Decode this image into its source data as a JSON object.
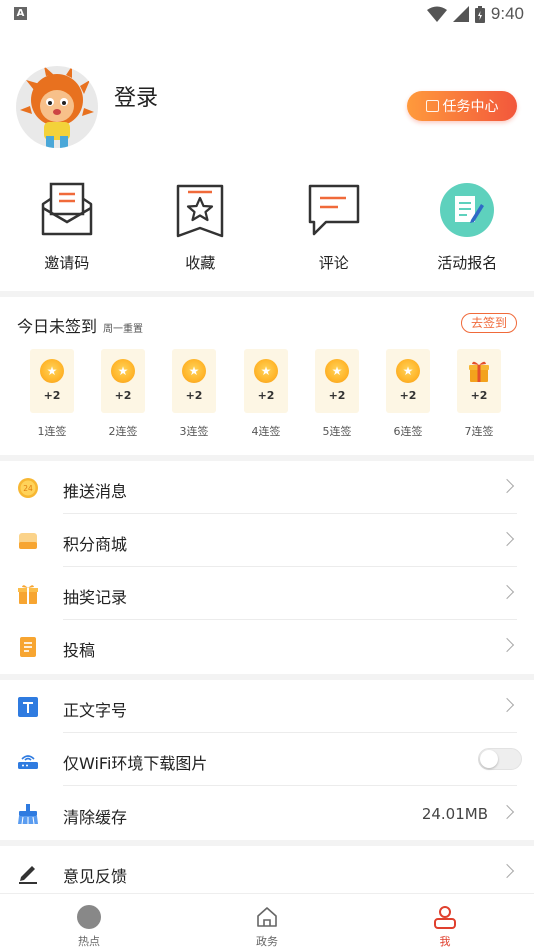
{
  "status_bar": {
    "time": "9:40",
    "notif_letter": "A"
  },
  "profile": {
    "login_label": "登录",
    "task_center_label": "任务中心"
  },
  "quick_actions": [
    {
      "label": "邀请码",
      "icon": "envelope-icon"
    },
    {
      "label": "收藏",
      "icon": "star-bookmark-icon"
    },
    {
      "label": "评论",
      "icon": "comment-icon"
    },
    {
      "label": "活动报名",
      "icon": "signup-form-icon"
    }
  ],
  "sign_in": {
    "title": "今日未签到",
    "subtitle": "周一重置",
    "go_label": "去签到",
    "days": [
      {
        "points": "+2",
        "label": "1连签",
        "reward": "coin"
      },
      {
        "points": "+2",
        "label": "2连签",
        "reward": "coin"
      },
      {
        "points": "+2",
        "label": "3连签",
        "reward": "coin"
      },
      {
        "points": "+2",
        "label": "4连签",
        "reward": "coin"
      },
      {
        "points": "+2",
        "label": "5连签",
        "reward": "coin"
      },
      {
        "points": "+2",
        "label": "6连签",
        "reward": "coin"
      },
      {
        "points": "+2",
        "label": "7连签",
        "reward": "gift"
      }
    ]
  },
  "menu_group1": [
    {
      "label": "推送消息",
      "icon": "push-24-icon"
    },
    {
      "label": "积分商城",
      "icon": "points-mall-icon"
    },
    {
      "label": "抽奖记录",
      "icon": "gift-box-icon"
    },
    {
      "label": "投稿",
      "icon": "document-icon"
    }
  ],
  "menu_group2": [
    {
      "label": "正文字号",
      "icon": "text-size-icon"
    },
    {
      "label": "仅WiFi环境下载图片",
      "icon": "wifi-router-icon",
      "toggle": false
    },
    {
      "label": "清除缓存",
      "icon": "broom-icon",
      "value": "24.01MB"
    }
  ],
  "menu_group3": [
    {
      "label": "意见反馈",
      "icon": "pencil-icon"
    }
  ],
  "bottom_nav": [
    {
      "label": "热点",
      "icon": "hot-icon",
      "active": false
    },
    {
      "label": "政务",
      "icon": "home-icon",
      "active": false
    },
    {
      "label": "我",
      "icon": "person-icon",
      "active": true
    }
  ],
  "colors": {
    "accent": "#f06a3a",
    "nav_active": "#e0402e",
    "separator": "#f3f3f3"
  }
}
